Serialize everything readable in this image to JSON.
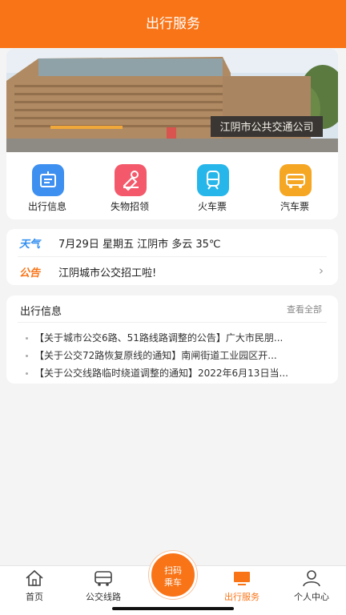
{
  "header": {
    "title": "出行服务"
  },
  "banner": {
    "sign_text": "江阴市公共交通公司"
  },
  "quick_actions": [
    {
      "label": "出行信息",
      "icon": "info-board-icon",
      "color": "#3d8ff0"
    },
    {
      "label": "失物招领",
      "icon": "lost-found-icon",
      "color": "#f3596a"
    },
    {
      "label": "火车票",
      "icon": "train-icon",
      "color": "#26b6ea"
    },
    {
      "label": "汽车票",
      "icon": "bus-icon",
      "color": "#f5a623"
    }
  ],
  "weather": {
    "tag": "天气",
    "text": "7月29日 星期五 江阴市 多云 35℃"
  },
  "notice": {
    "tag": "公告",
    "text": "江阴城市公交招工啦!"
  },
  "news": {
    "title": "出行信息",
    "view_all": "查看全部",
    "items": [
      "【关于城市公交6路、51路线路调整的公告】广大市民朋...",
      "【关于公交72路恢复原线的通知】南闸街道工业园区开...",
      "【关于公交线路临时绕道调整的通知】2022年6月13日当..."
    ]
  },
  "tabbar": {
    "home": "首页",
    "routes": "公交线路",
    "scan_line1": "扫码",
    "scan_line2": "乘车",
    "services": "出行服务",
    "profile": "个人中心"
  },
  "colors": {
    "accent": "#f97417"
  }
}
